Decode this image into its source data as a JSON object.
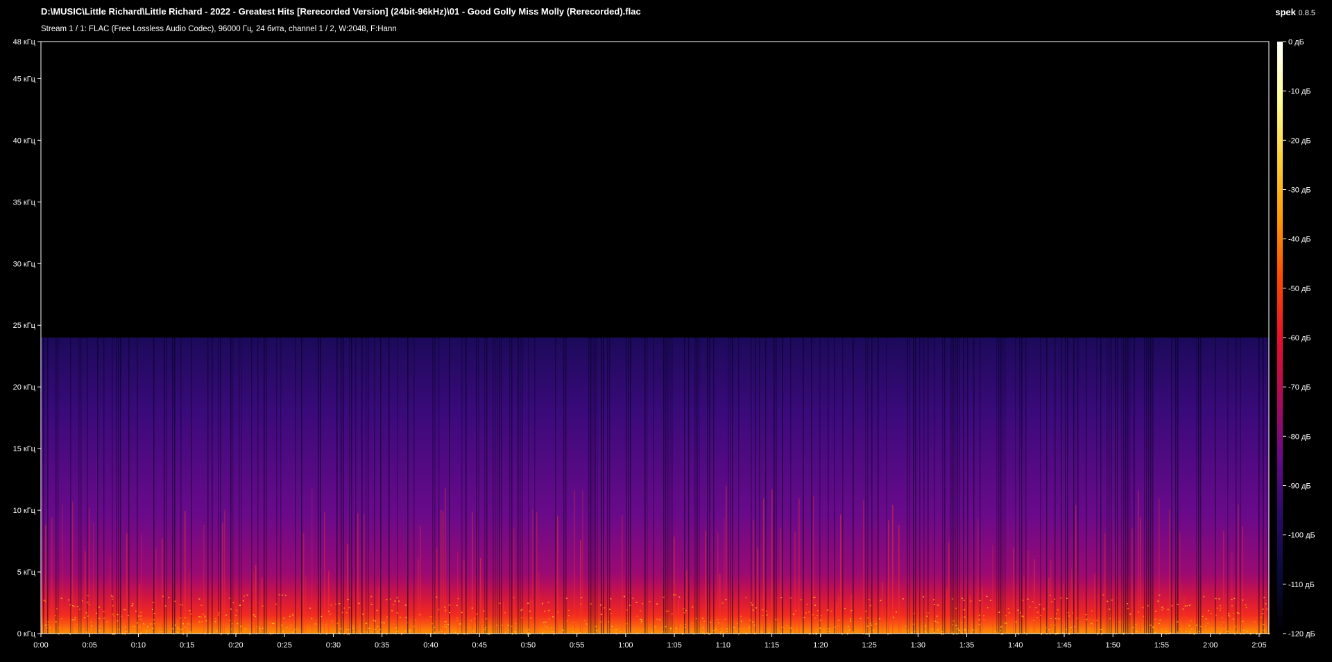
{
  "header": {
    "title": "D:\\MUSIC\\Little Richard\\Little Richard - 2022 - Greatest Hits [Rerecorded Version] (24bit-96kHz)\\01 - Good Golly Miss Molly (Rerecorded).flac",
    "subtitle": "Stream 1 / 1: FLAC (Free Lossless Audio Codec), 96000 Гц, 24 бита, channel 1 / 2, W:2048, F:Hann",
    "app_name": "spek",
    "app_version": "0.8.5"
  },
  "chart_data": {
    "type": "heatmap",
    "description_type": "spectrogram",
    "x_axis": {
      "unit": "time",
      "range_seconds": [
        0,
        126
      ],
      "ticks": [
        {
          "t": 0,
          "label": "0:00"
        },
        {
          "t": 5,
          "label": "0:05"
        },
        {
          "t": 10,
          "label": "0:10"
        },
        {
          "t": 15,
          "label": "0:15"
        },
        {
          "t": 20,
          "label": "0:20"
        },
        {
          "t": 25,
          "label": "0:25"
        },
        {
          "t": 30,
          "label": "0:30"
        },
        {
          "t": 35,
          "label": "0:35"
        },
        {
          "t": 40,
          "label": "0:40"
        },
        {
          "t": 45,
          "label": "0:45"
        },
        {
          "t": 50,
          "label": "0:50"
        },
        {
          "t": 55,
          "label": "0:55"
        },
        {
          "t": 60,
          "label": "1:00"
        },
        {
          "t": 65,
          "label": "1:05"
        },
        {
          "t": 70,
          "label": "1:10"
        },
        {
          "t": 75,
          "label": "1:15"
        },
        {
          "t": 80,
          "label": "1:20"
        },
        {
          "t": 85,
          "label": "1:25"
        },
        {
          "t": 90,
          "label": "1:30"
        },
        {
          "t": 95,
          "label": "1:35"
        },
        {
          "t": 100,
          "label": "1:40"
        },
        {
          "t": 105,
          "label": "1:45"
        },
        {
          "t": 110,
          "label": "1:50"
        },
        {
          "t": 115,
          "label": "1:55"
        },
        {
          "t": 120,
          "label": "2:00"
        },
        {
          "t": 125,
          "label": "2:05"
        }
      ]
    },
    "y_axis": {
      "unit": "kHz",
      "range": [
        0,
        48
      ],
      "ticks": [
        {
          "v": 0,
          "label": "0 кГц"
        },
        {
          "v": 5,
          "label": "5 кГц"
        },
        {
          "v": 10,
          "label": "10 кГц"
        },
        {
          "v": 15,
          "label": "15 кГц"
        },
        {
          "v": 20,
          "label": "20 кГц"
        },
        {
          "v": 25,
          "label": "25 кГц"
        },
        {
          "v": 30,
          "label": "30 кГц"
        },
        {
          "v": 35,
          "label": "35 кГц"
        },
        {
          "v": 40,
          "label": "40 кГц"
        },
        {
          "v": 45,
          "label": "45 кГц"
        },
        {
          "v": 48,
          "label": "48 кГц"
        }
      ]
    },
    "content_cutoff_khz": 24,
    "color_scale": {
      "unit": "dB",
      "range": [
        -120,
        0
      ],
      "ticks": [
        {
          "v": 0,
          "label": "0 дБ"
        },
        {
          "v": -10,
          "label": "-10 дБ"
        },
        {
          "v": -20,
          "label": "-20 дБ"
        },
        {
          "v": -30,
          "label": "-30 дБ"
        },
        {
          "v": -40,
          "label": "-40 дБ"
        },
        {
          "v": -50,
          "label": "-50 дБ"
        },
        {
          "v": -60,
          "label": "-60 дБ"
        },
        {
          "v": -70,
          "label": "-70 дБ"
        },
        {
          "v": -80,
          "label": "-80 дБ"
        },
        {
          "v": -90,
          "label": "-90 дБ"
        },
        {
          "v": -100,
          "label": "-100 дБ"
        },
        {
          "v": -110,
          "label": "-110 дБ"
        },
        {
          "v": -120,
          "label": "-120 дБ"
        }
      ],
      "colors": [
        "#000000",
        "#0a0a3a",
        "#2a0a6a",
        "#6a0a8a",
        "#b00a5a",
        "#e8102a",
        "#ff4a00",
        "#ff9a00",
        "#ffd030",
        "#ffff90",
        "#ffffff"
      ]
    }
  }
}
